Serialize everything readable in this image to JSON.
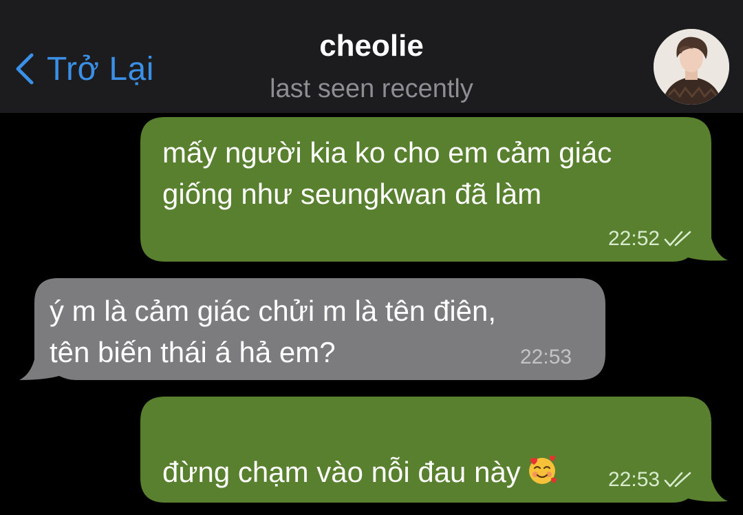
{
  "header": {
    "back_label": "Trở Lại",
    "title": "cheolie",
    "subtitle": "last seen recently"
  },
  "messages": [
    {
      "direction": "outgoing",
      "text": "mấy người kia ko cho em cảm giác\ngiống như seungkwan đã làm",
      "time": "22:52",
      "status": "read"
    },
    {
      "direction": "incoming",
      "text": "ý m là cảm giác chửi m là tên điên,\ntên biến thái á hả em?",
      "time": "22:53"
    },
    {
      "direction": "outgoing",
      "text": "đừng chạm vào nỗi đau này",
      "time": "22:53",
      "status": "read",
      "emoji": "smiling-face-with-hearts"
    }
  ],
  "colors": {
    "header_bg": "#1c1c1e",
    "outgoing_bubble": "#58802f",
    "incoming_bubble": "#7c7c7e",
    "accent": "#3a90e6"
  }
}
